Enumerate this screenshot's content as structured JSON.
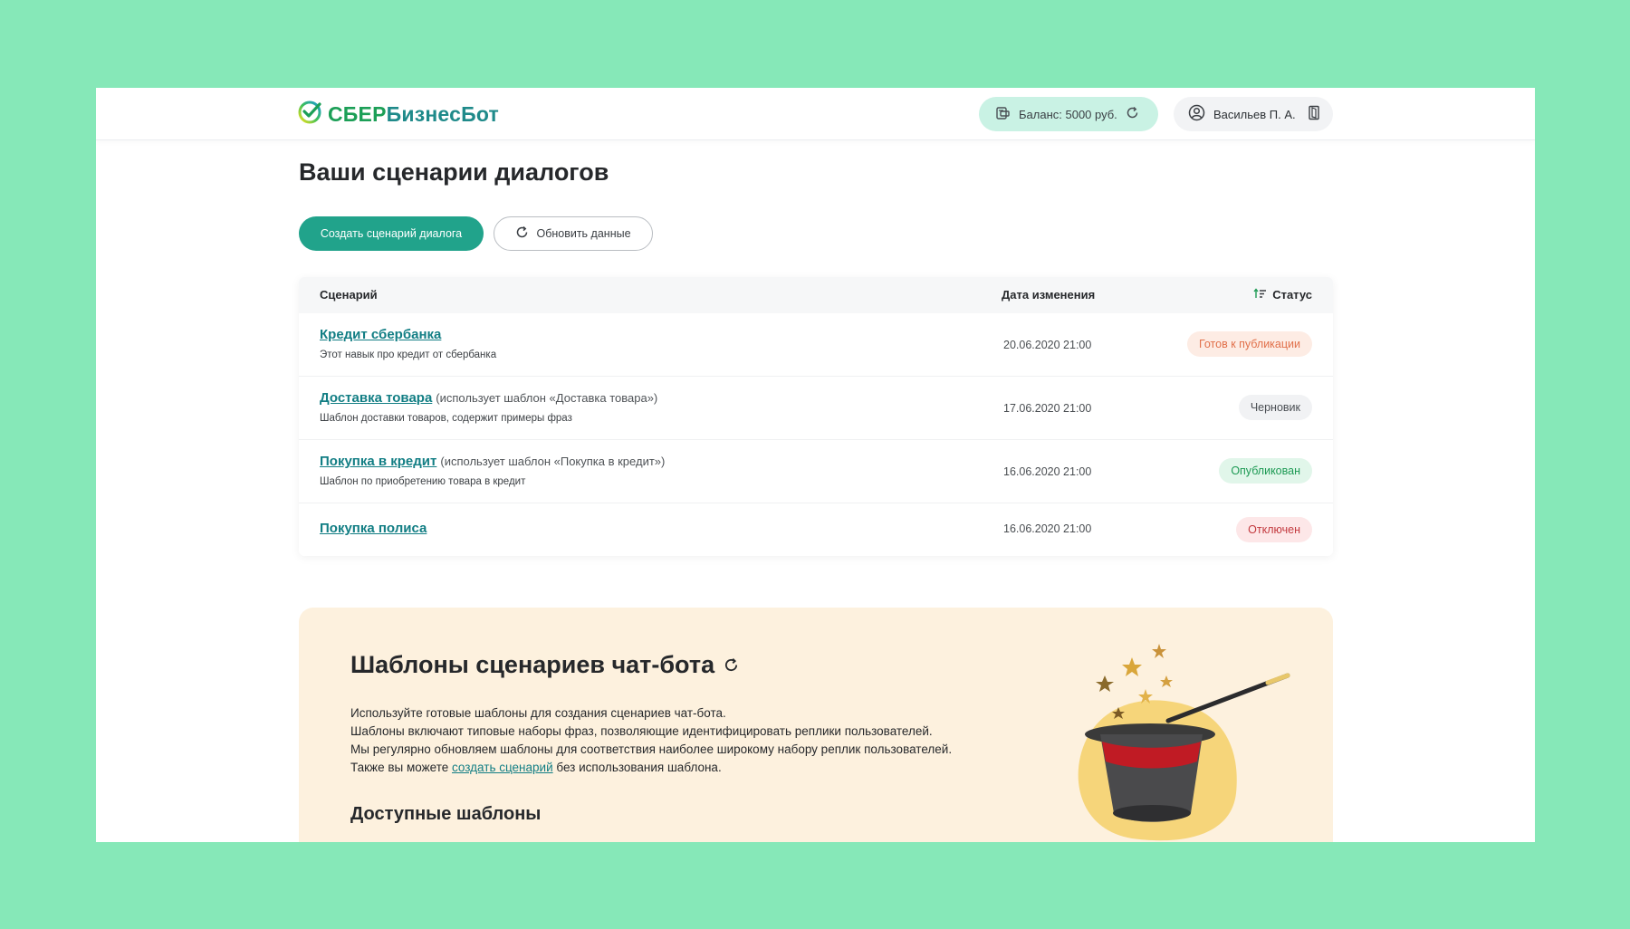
{
  "header": {
    "logo_part1": "СБЕР",
    "logo_part2": "БизнесБот",
    "balance_label": "Баланс: 5000 руб.",
    "user_name": "Васильев П. А."
  },
  "page": {
    "title": "Ваши сценарии диалогов",
    "create_button": "Создать сценарий диалога",
    "refresh_button": "Обновить данные"
  },
  "table": {
    "col_scenario": "Сценарий",
    "col_date": "Дата изменения",
    "col_status": "Статус",
    "rows": [
      {
        "title": "Кредит сбербанка",
        "note": "",
        "description": "Этот навык про кредит от сбербанка",
        "date": "20.06.2020 21:00",
        "status": "Готов к публикации"
      },
      {
        "title": "Доставка товара",
        "note": "(использует шаблон «Доставка товара»)",
        "description": "Шаблон доставки товаров, содержит примеры фраз",
        "date": "17.06.2020 21:00",
        "status": "Черновик"
      },
      {
        "title": "Покупка в кредит",
        "note": "(использует шаблон «Покупка в кредит»)",
        "description": "Шаблон по приобретению товара в кредит",
        "date": "16.06.2020 21:00",
        "status": "Опубликован"
      },
      {
        "title": "Покупка полиса",
        "note": "",
        "description": "",
        "date": "16.06.2020 21:00",
        "status": "Отключен"
      }
    ]
  },
  "templates": {
    "title": "Шаблоны сценариев чат-бота",
    "line1": "Используйте готовые шаблоны для создания сценариев чат-бота.",
    "line2": "Шаблоны включают типовые наборы фраз, позволяющие идентифицировать реплики пользователей.",
    "line3": "Мы регулярно обновляем шаблоны для соответствия наиболее широкому набору реплик пользователей.",
    "line4_before": "Также вы можете",
    "line4_link": "создать сценарий",
    "line4_after": "без использования шаблона.",
    "subtitle": "Доступные шаблоны"
  },
  "colors": {
    "background": "#86e8b8",
    "brand_green": "#21a38b",
    "link": "#127e84",
    "status_ready": "#e1704a",
    "status_published": "#1d9a54",
    "status_disabled": "#c33a3f"
  },
  "icons": [
    "sber-logo-icon",
    "wallet-icon",
    "refresh-icon",
    "user-circle-icon",
    "logout-icon",
    "sort-icon",
    "magic-hat-illustration"
  ]
}
